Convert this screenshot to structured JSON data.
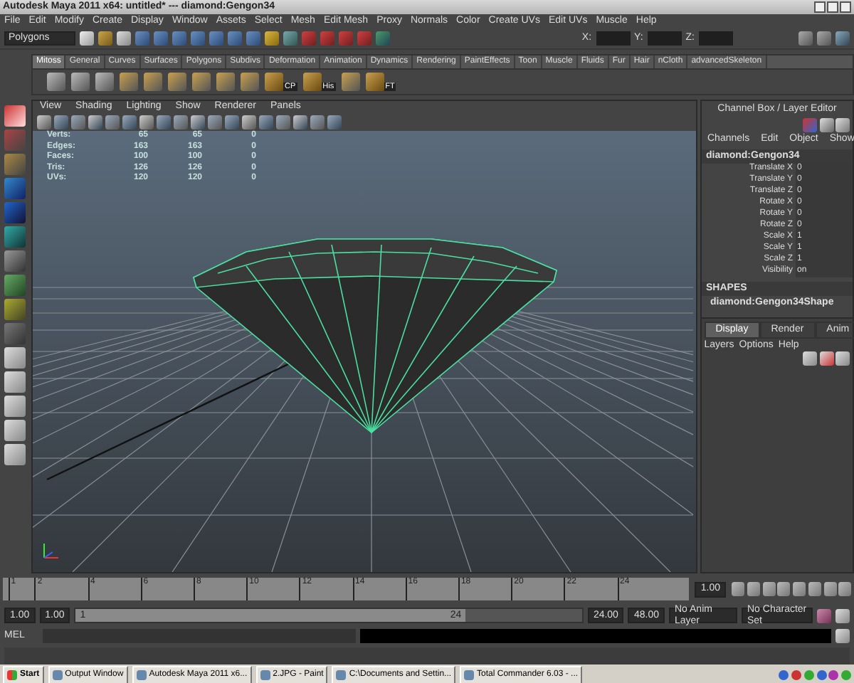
{
  "window": {
    "title": "Autodesk Maya 2011 x64: untitled*   ---   diamond:Gengon34"
  },
  "menu_bar": [
    "File",
    "Edit",
    "Modify",
    "Create",
    "Display",
    "Window",
    "Assets",
    "Select",
    "Mesh",
    "Edit Mesh",
    "Proxy",
    "Normals",
    "Color",
    "Create UVs",
    "Edit UVs",
    "Muscle",
    "Help"
  ],
  "status_line": {
    "menu_set": "Polygons",
    "coordinate_labels": [
      "X:",
      "Y:",
      "Z:"
    ]
  },
  "shelf": {
    "tabs": [
      {
        "label": "Mitoss",
        "selected": true
      },
      {
        "label": "General",
        "selected": false
      },
      {
        "label": "Curves",
        "selected": false
      },
      {
        "label": "Surfaces",
        "selected": false
      },
      {
        "label": "Polygons",
        "selected": false
      },
      {
        "label": "Subdivs",
        "selected": false
      },
      {
        "label": "Deformation",
        "selected": false
      },
      {
        "label": "Animation",
        "selected": false
      },
      {
        "label": "Dynamics",
        "selected": false
      },
      {
        "label": "Rendering",
        "selected": false
      },
      {
        "label": "PaintEffects",
        "selected": false
      },
      {
        "label": "Toon",
        "selected": false
      },
      {
        "label": "Muscle",
        "selected": false
      },
      {
        "label": "Fluids",
        "selected": false
      },
      {
        "label": "Fur",
        "selected": false
      },
      {
        "label": "Hair",
        "selected": false
      },
      {
        "label": "nCloth",
        "selected": false
      },
      {
        "label": "advancedSkeleton",
        "selected": false
      }
    ],
    "tool_labels": [
      "CP",
      "His",
      "FT"
    ]
  },
  "viewport": {
    "menu": [
      "View",
      "Shading",
      "Lighting",
      "Show",
      "Renderer",
      "Panels"
    ],
    "hud": [
      {
        "label": "Verts:",
        "values": [
          "65",
          "65",
          "0"
        ]
      },
      {
        "label": "Edges:",
        "values": [
          "163",
          "163",
          "0"
        ]
      },
      {
        "label": "Faces:",
        "values": [
          "100",
          "100",
          "0"
        ]
      },
      {
        "label": "Tris:",
        "values": [
          "126",
          "126",
          "0"
        ]
      },
      {
        "label": "UVs:",
        "values": [
          "120",
          "120",
          "0"
        ]
      }
    ]
  },
  "channel_box": {
    "title": "Channel Box / Layer Editor",
    "menu": [
      "Channels",
      "Edit",
      "Object",
      "Show"
    ],
    "object": "diamond:Gengon34",
    "attributes": [
      {
        "name": "Translate X",
        "value": "0"
      },
      {
        "name": "Translate Y",
        "value": "0"
      },
      {
        "name": "Translate Z",
        "value": "0"
      },
      {
        "name": "Rotate X",
        "value": "0"
      },
      {
        "name": "Rotate Y",
        "value": "0"
      },
      {
        "name": "Rotate Z",
        "value": "0"
      },
      {
        "name": "Scale X",
        "value": "1"
      },
      {
        "name": "Scale Y",
        "value": "1"
      },
      {
        "name": "Scale Z",
        "value": "1"
      },
      {
        "name": "Visibility",
        "value": "on"
      }
    ],
    "shapes_heading": "SHAPES",
    "shape": "diamond:Gengon34Shape"
  },
  "layer_editor": {
    "tabs": [
      {
        "label": "Display",
        "selected": true
      },
      {
        "label": "Render",
        "selected": false
      },
      {
        "label": "Anim",
        "selected": false
      }
    ],
    "menu": [
      "Layers",
      "Options",
      "Help"
    ]
  },
  "time_slider": {
    "ticks": [
      "1",
      "2",
      "4",
      "6",
      "8",
      "10",
      "12",
      "14",
      "16",
      "18",
      "20",
      "22",
      "24"
    ],
    "current_time": "1.00"
  },
  "range_slider": {
    "start": "1.00",
    "range_start": "1.00",
    "level": 0.77,
    "handle_start": "1",
    "handle_end": "24",
    "range_end": "24.00",
    "end": "48.00",
    "anim_layer": "No Anim Layer",
    "character_set": "No Character Set"
  },
  "command_line": {
    "label": "MEL"
  },
  "taskbar": {
    "start": "Start",
    "tasks": [
      "Output Window",
      "Autodesk Maya 2011 x6...",
      "2.JPG - Paint",
      "C:\\Documents and Settin...",
      "Total Commander 6.03 - ..."
    ]
  }
}
